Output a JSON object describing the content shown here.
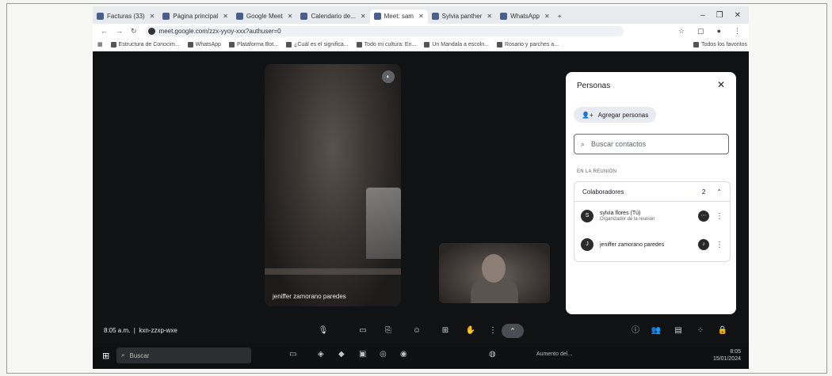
{
  "tabs": [
    {
      "label": "Facturas (33)"
    },
    {
      "label": "Página principal"
    },
    {
      "label": "Google Meet"
    },
    {
      "label": "Calendario de..."
    },
    {
      "label": "Meet: sam",
      "active": true
    },
    {
      "label": "Sylvia panther"
    },
    {
      "label": "WhatsApp"
    }
  ],
  "address": {
    "url": "meet.google.com/zzx-yyoy-xxx?authuser=0"
  },
  "bookmarks": [
    "Estructura de Conocim...",
    "WhatsApp",
    "Plataforma Bot...",
    "¿Cuál es el significa...",
    "Todo mi cultura: En...",
    "Un Mandala a escoln...",
    "Rosario y parches a..."
  ],
  "bookmarks_all": "Todos los favoritos",
  "meet": {
    "main_tile_name": "jeniffer zamorano paredes",
    "meeting_time": "8:05 a.m.",
    "meeting_code": "kxn-zzxp-wxe"
  },
  "panel": {
    "title": "Personas",
    "add_label": "Agregar personas",
    "search_placeholder": "Buscar contactos",
    "section_label": "EN LA REUNIÓN",
    "group_label": "Colaboradores",
    "group_count": "2",
    "people": [
      {
        "initial": "S",
        "name": "sylvia flores (Tú)",
        "role": "Organizador de la reunión"
      },
      {
        "initial": "J",
        "name": "jeniffer zamorano paredes",
        "role": ""
      }
    ]
  },
  "taskbar": {
    "search": "Buscar",
    "tray": "Aumento del...",
    "clock_time": "8:05",
    "clock_date": "15/01/2024"
  },
  "colors": {
    "accent": "#e8ecf2",
    "meet_bg": "#111214"
  }
}
